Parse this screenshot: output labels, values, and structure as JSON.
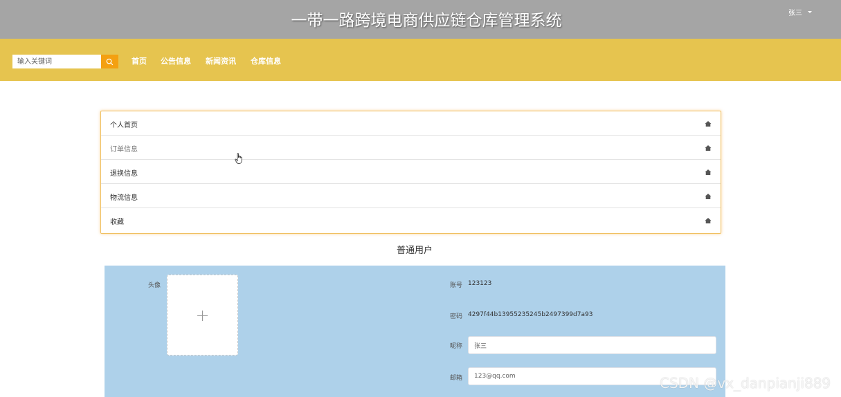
{
  "header": {
    "title": "一带一路跨境电商供应链仓库管理系统",
    "user_name": "张三"
  },
  "nav": {
    "search_placeholder": "输入关键词",
    "items": [
      {
        "label": "首页"
      },
      {
        "label": "公告信息"
      },
      {
        "label": "新闻资讯"
      },
      {
        "label": "仓库信息"
      }
    ]
  },
  "menu": {
    "items": [
      {
        "label": "个人首页"
      },
      {
        "label": "订单信息"
      },
      {
        "label": "退换信息"
      },
      {
        "label": "物流信息"
      },
      {
        "label": "收藏"
      }
    ]
  },
  "profile": {
    "section_title": "普通用户",
    "avatar_label": "头像",
    "avatar_add": "+",
    "account_label": "账号",
    "account_value": "123123",
    "password_label": "密码",
    "password_value": "4297f44b13955235245b2497399d7a93",
    "nickname_label": "昵称",
    "nickname_value": "张三",
    "email_label": "邮箱",
    "email_value": "123@qq.com"
  },
  "watermark": "CSDN @vx_danpianji889",
  "colors": {
    "topbar": "#a5a5a5",
    "navbar": "#e6c44f",
    "search_button": "#f4a011",
    "form_panel": "#aed1ea"
  }
}
